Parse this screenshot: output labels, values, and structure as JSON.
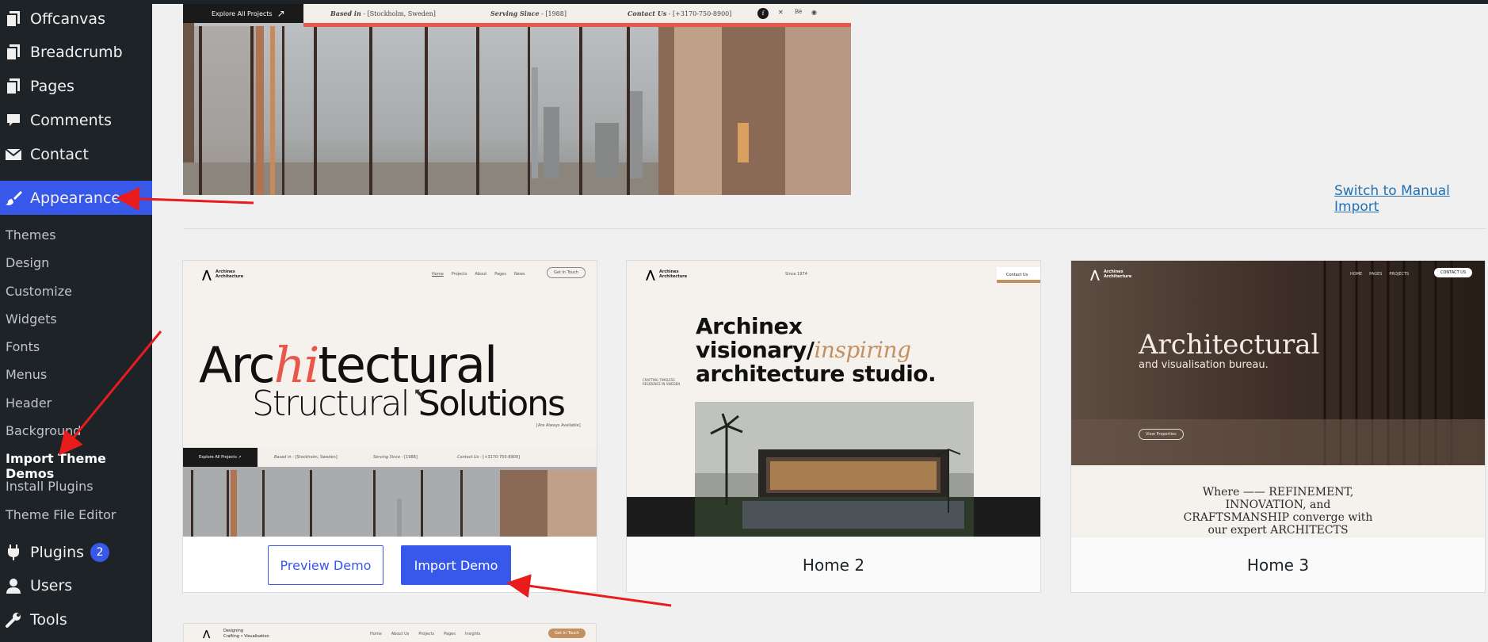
{
  "sidebar": {
    "items_top": [
      {
        "label": "Offcanvas",
        "icon": "pages-icon"
      },
      {
        "label": "Breadcrumb",
        "icon": "pages-icon"
      },
      {
        "label": "Pages",
        "icon": "pages-icon"
      },
      {
        "label": "Comments",
        "icon": "comment-icon"
      },
      {
        "label": "Contact",
        "icon": "mail-icon"
      }
    ],
    "active": {
      "label": "Appearance",
      "icon": "paintbrush-icon"
    },
    "submenu": [
      "Themes",
      "Design",
      "Customize",
      "Widgets",
      "Fonts",
      "Menus",
      "Header",
      "Background",
      "Import Theme Demos",
      "Install Plugins",
      "Theme File Editor"
    ],
    "current_sub": "Import Theme Demos",
    "items_bottom": [
      {
        "label": "Plugins",
        "icon": "plugin-icon",
        "badge": "2"
      },
      {
        "label": "Users",
        "icon": "user-icon"
      },
      {
        "label": "Tools",
        "icon": "wrench-icon"
      }
    ]
  },
  "hero": {
    "cta": "Explore All Projects",
    "based_in_label": "Based in",
    "based_in_value": "[Stockholm, Sweden]",
    "serving_label": "Serving Since",
    "serving_value": "[1988]",
    "contact_label": "Contact Us",
    "contact_value": "[+3170-750-8900]"
  },
  "switch_link": "Switch to Manual Import",
  "cards": [
    {
      "brand": "Archinex Architecture",
      "nav": [
        "Home",
        "Projects",
        "About",
        "Pages",
        "News"
      ],
      "nav_btn": "Get In Touch",
      "headline_a": "Arc",
      "headline_b": "hi",
      "headline_c": "tectural",
      "headline2_a": "Structural",
      "headline2_b": "Solutions",
      "tag": "[Are Always Available]",
      "preview_label": "Preview Demo",
      "import_label": "Import Demo"
    },
    {
      "title": "Home 2",
      "brand": "Archinex Architecture",
      "since": "Since 1974",
      "contact": "Contact Us",
      "line1": "Archinex",
      "line2a": "visionary/",
      "line2b": "inspiring",
      "line3": "architecture studio.",
      "side": "CRAFTING TIMELESS RESIDENCE IN SWEDEN"
    },
    {
      "title": "Home 3",
      "brand": "Archinex Architecture",
      "nav": [
        "HOME",
        "PAGES",
        "PROJECTS"
      ],
      "contact": "CONTACT US",
      "heading": "Architectural",
      "sub": "and visualisation bureau.",
      "btn": "View Properties",
      "quote_l1": "Where —— REFINEMENT,",
      "quote_l2": "INNOVATION, and",
      "quote_l3": "CRAFTSMANSHIP converge with",
      "quote_l4": "our expert ARCHITECTS"
    }
  ],
  "card4": {
    "nav": [
      "Home",
      "About Us",
      "Projects",
      "Pages",
      "Insights"
    ],
    "btn": "Get In Touch",
    "brand_l1": "Designing",
    "brand_l2": "Crafting • Visualisation"
  },
  "colors": {
    "sidebar": "#1d2327",
    "accent": "#3858e9",
    "red": "#e8574a"
  }
}
